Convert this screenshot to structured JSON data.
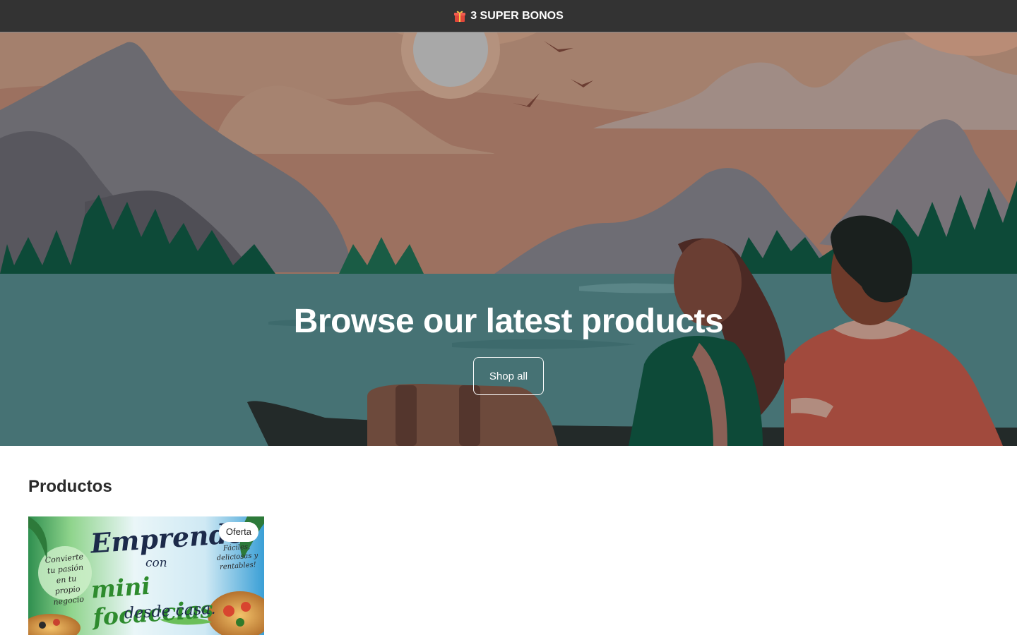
{
  "announcement": {
    "icon": "gift-icon",
    "text": "3 SUPER BONOS"
  },
  "hero": {
    "title": "Browse our latest products",
    "button_label": "Shop all"
  },
  "products": {
    "heading": "Productos",
    "items": [
      {
        "badge": "Oferta",
        "image_text": {
          "main": "Emprende",
          "connector": "con",
          "product": "mini focaccias",
          "tagline": "desde casa.",
          "left_note": "Convierte tu pasión en tu propio negocio",
          "right_note": "Fáciles, deliciosas y rentables!"
        }
      }
    ]
  },
  "colors": {
    "announcement_bg": "#333333",
    "hero_sky": "#9c7160",
    "hero_water": "#467274",
    "forest": "#0d4a38"
  }
}
